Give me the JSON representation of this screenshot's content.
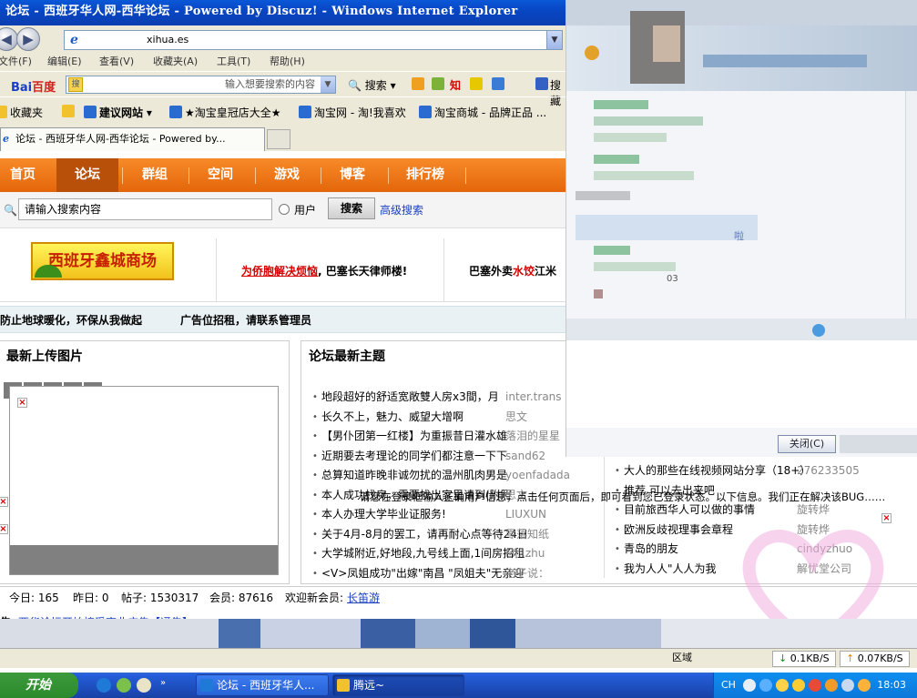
{
  "window": {
    "title": "论坛 - 西班牙华人网-西华论坛 - Powered by Discuz! - Windows Internet Explorer"
  },
  "address": {
    "url": "xihua.es"
  },
  "menu": [
    "文件(F)",
    "编辑(E)",
    "查看(V)",
    "收藏夹(A)",
    "工具(T)",
    "帮助(H)"
  ],
  "toolbar": {
    "baidu_logo": "Bai",
    "baidu_logo_tail": "百度",
    "search_placeholder": "输入想要搜索的内容",
    "search_label": "搜索",
    "search_label_2": "搜藏",
    "know": "知"
  },
  "favorites": {
    "label": "收藏夹",
    "items": [
      "建议网站",
      "★淘宝皇冠店大全★",
      "淘宝网 - 淘!我喜欢",
      "淘宝商城 - 品牌正品 ..."
    ]
  },
  "tab": {
    "title": "论坛 - 西班牙华人网-西华论坛 - Powered by..."
  },
  "nav": [
    "首页",
    "论坛",
    "群组",
    "空间",
    "游戏",
    "博客",
    "排行榜"
  ],
  "search": {
    "placeholder": "请输入搜索内容",
    "radio_label": "用户",
    "button": "搜索",
    "advanced": "高级搜索"
  },
  "ads": {
    "banner": "西班牙鑫城商场",
    "ad1_link": "为侨胞解决烦恼",
    "ad1_rest": ", 巴塞长天律师楼!",
    "ad2_pre": "巴塞外卖",
    "ad2_hl": "水饺",
    "ad2_post": "江米"
  },
  "notice": {
    "left": "防止地球暖化，环保从我做起",
    "right": "广告位招租，请联系管理员"
  },
  "photos": {
    "title": "最新上传图片",
    "pages": [
      "1",
      "2",
      "3",
      "4",
      "5",
      "6"
    ]
  },
  "threads": {
    "title": "论坛最新主题",
    "left": [
      {
        "title": "地段超好的舒适宽敞雙人房x3間，月",
        "author": "inter.trans"
      },
      {
        "title": "长久不上，魅力、威望大增啊",
        "author": "思文"
      },
      {
        "title": "【男仆团第一红楼】为重振昔日灌水雄",
        "author": "落泪的星星"
      },
      {
        "title": "近期要去考理论的同学们都注意一下下",
        "author": "sand62"
      },
      {
        "title": "总算知道昨晚非诚勿扰的温州肌肉男是",
        "author": "yoenfadada"
      },
      {
        "title": "本人成功找房，需要找出家里请到(附照",
        "author": "思文"
      },
      {
        "title": "本人办理大学毕业证服务!",
        "author": "LIUXUN"
      },
      {
        "title": "关于4月-8月的罢工，请再耐心点等待24日",
        "author": "零落知纸"
      },
      {
        "title": "大学城附近,好地段,九号线上面,1间房招租..",
        "author": "Mr..zhu"
      },
      {
        "title": "<V>凤姐成功\"出嫁\"南昌 \"凤姐夫\"无亲迎",
        "author": "老子说："
      }
    ],
    "right": [
      {
        "title": "大人的那些在线视频网站分享（18+）",
        "author": "276233505"
      },
      {
        "title": "推荐 可以去出来吧",
        "author": ""
      },
      {
        "title": "目前旅西华人可以做的事情",
        "author": "旋转烨"
      },
      {
        "title": "欧洲反歧视理事会章程",
        "author": "旋转烨"
      },
      {
        "title": "青岛的朋友",
        "author": "cindyzhuo"
      },
      {
        "title": "我为人人\"人人为我",
        "author": "解忧堂公司"
      }
    ]
  },
  "stats": {
    "today": "今日: 165",
    "yesterday": "昨日: 0",
    "posts": "帖子: 1530317",
    "members": "会员: 87616",
    "newmember_label": "欢迎新会员:",
    "newmember": "长笛游"
  },
  "marquee": {
    "label": "告:",
    "text": "西华论坛开始接受商业广告【通告】"
  },
  "overlay_msg": "请您在登录框输入正确用户信息，点击任何页面后，即可看到您已登录状态。以下信息。我们正在解决该BUG……",
  "popup": {
    "close_button": "关闭(C)",
    "text1": "啦",
    "text2": "03"
  },
  "statusbar": {
    "zone": "区域",
    "down": "0.1KB/S",
    "up": "0.07KB/S"
  },
  "taskbar": {
    "start": "开始",
    "task1": "论坛 - 西班牙华人...",
    "task2": "腾远~",
    "lang": "CH",
    "clock": "18:03"
  },
  "colors": {
    "orange": "#f07a1a",
    "accent_blue": "#1941a5",
    "link_blue": "#1a3fc4",
    "link_red": "#d60000"
  }
}
